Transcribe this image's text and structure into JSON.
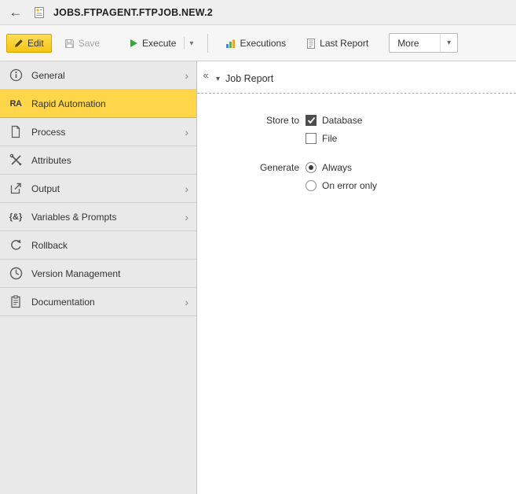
{
  "glyphs": {
    "back": "←",
    "collapse": "«",
    "chevron_right": "›",
    "dropdown": "▾",
    "section_toggle": "▾"
  },
  "titlebar": {
    "title": "JOBS.FTPAGENT.FTPJOB.NEW.2"
  },
  "toolbar": {
    "edit_label": "Edit",
    "save_label": "Save",
    "execute_label": "Execute",
    "executions_label": "Executions",
    "last_report_label": "Last Report",
    "more_label": "More"
  },
  "sidebar": {
    "ra_badge": "RA",
    "variables_glyph": "{&}",
    "items": [
      {
        "label": "General",
        "icon": "info-icon",
        "has_submenu": true,
        "selected": false
      },
      {
        "label": "Rapid Automation",
        "icon": "ra-badge-icon",
        "has_submenu": false,
        "selected": true
      },
      {
        "label": "Process",
        "icon": "process-icon",
        "has_submenu": true,
        "selected": false
      },
      {
        "label": "Attributes",
        "icon": "tools-icon",
        "has_submenu": false,
        "selected": false
      },
      {
        "label": "Output",
        "icon": "output-icon",
        "has_submenu": true,
        "selected": false
      },
      {
        "label": "Variables & Prompts",
        "icon": "variables-icon",
        "has_submenu": true,
        "selected": false
      },
      {
        "label": "Rollback",
        "icon": "rollback-icon",
        "has_submenu": false,
        "selected": false
      },
      {
        "label": "Version Management",
        "icon": "clock-icon",
        "has_submenu": false,
        "selected": false
      },
      {
        "label": "Documentation",
        "icon": "clipboard-icon",
        "has_submenu": true,
        "selected": false
      }
    ]
  },
  "main": {
    "section_title": "Job Report",
    "store_to": {
      "label": "Store to",
      "options": [
        {
          "label": "Database",
          "type": "checkbox",
          "checked": true
        },
        {
          "label": "File",
          "type": "checkbox",
          "checked": false
        }
      ]
    },
    "generate": {
      "label": "Generate",
      "options": [
        {
          "label": "Always",
          "type": "radio",
          "selected": true
        },
        {
          "label": "On error only",
          "type": "radio",
          "selected": false
        }
      ]
    }
  },
  "colors": {
    "accent_yellow": "#ffd64a",
    "execute_green": "#3fa43f",
    "selected_sidebar": "#ffd64a"
  }
}
